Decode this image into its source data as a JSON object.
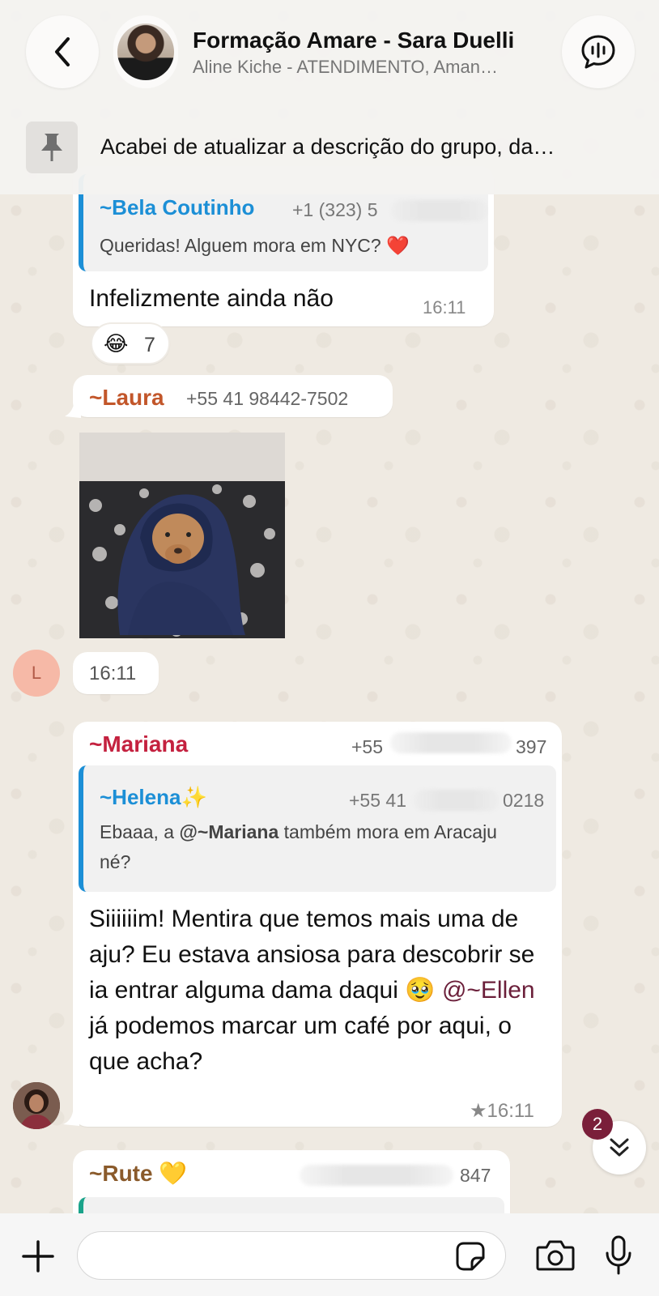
{
  "header": {
    "title": "Formação Amare - Sara Duelli",
    "subtitle": "Aline Kiche - ATENDIMENTO, Aman…",
    "pinned_text": "Acabei de atualizar a descrição do grupo, da…"
  },
  "messages": {
    "m1": {
      "quote_author": "~Bela Coutinho",
      "quote_phone": "+1 (323) 5",
      "quote_text": "Queridas! Alguem mora em NYC? ❤️",
      "text": "Infelizmente ainda não",
      "time": "16:11",
      "reaction_emoji": "😂",
      "reaction_count": "7"
    },
    "m2": {
      "sender": "~Laura",
      "phone": "+55 41 98442-7502",
      "time": "16:11",
      "avatar_letter": "L"
    },
    "m3": {
      "sender": "~Mariana",
      "phone_partial": "+55",
      "phone_end": "397",
      "quote_author": "~Helena✨",
      "quote_phone_partial": "+55 41",
      "quote_phone_end": "0218",
      "quote_text_pre": "Ebaaa, a ",
      "quote_mention": "@~Mariana",
      "quote_text_post": " também mora em Aracaju né?",
      "text_pre": "Siiiiiim! Mentira que temos mais uma de aju? Eu estava ansiosa para descobrir se ia entrar alguma dama daqui 🥹 ",
      "mention": "@~Ellen",
      "text_post": " já podemos marcar um café por aqui, o que acha?",
      "time": "★16:11"
    },
    "m4": {
      "sender": "~Rute 💛",
      "phone_end": "847"
    }
  },
  "scroll": {
    "unread_count": "2"
  },
  "composer": {
    "placeholder": ""
  },
  "colors": {
    "bela": "#1c8fd6",
    "laura": "#c2562a",
    "mariana": "#c4213f",
    "helena": "#1c8fd6",
    "rute": "#8a5a2b",
    "badge": "#7a1f3a"
  }
}
